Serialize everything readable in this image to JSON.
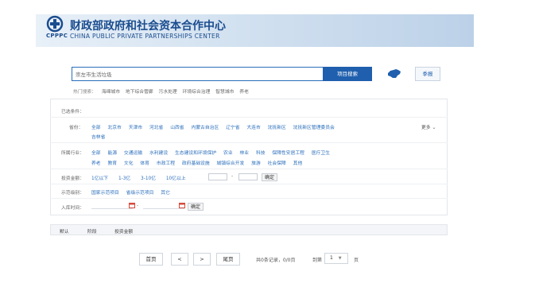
{
  "header": {
    "logo_text": "CPPPC",
    "title_cn": "财政部政府和社会资本合作中心",
    "title_en": "CHINA PUBLIC PRIVATE PARTNERSHIPS CENTER"
  },
  "search": {
    "value": "崇左市生活垃圾",
    "button_label": "项目搜索",
    "quarter_label": "季报"
  },
  "hot": {
    "label": "热门搜索：",
    "items": [
      "海绵城市",
      "地下综合管廊",
      "污水处理",
      "环境综合治理",
      "智慧城市",
      "养老"
    ]
  },
  "filters": {
    "selected_label": "已选条件：",
    "province": {
      "label": "省份：",
      "row1": [
        "全部",
        "北京市",
        "天津市",
        "河北省",
        "山西省",
        "内蒙古自治区",
        "辽宁省",
        "大连市",
        "沈抚新区",
        "沈抚新区管理委员会"
      ],
      "row2": [
        "吉林省"
      ],
      "more": "更多"
    },
    "industry": {
      "label": "所属行业：",
      "row1": [
        "全部",
        "能源",
        "交通运输",
        "水利建设",
        "生态建设和环境保护",
        "农业",
        "林业",
        "科技",
        "保障性安居工程",
        "医疗卫生"
      ],
      "row2": [
        "养老",
        "教育",
        "文化",
        "体育",
        "市政工程",
        "政府基础设施",
        "城镇综合开发",
        "旅游",
        "社会保障",
        "其他"
      ]
    },
    "amount": {
      "label": "投资金额：",
      "options": [
        "1亿以下",
        "1-3亿",
        "3-10亿",
        "10亿以上"
      ],
      "dash": "-",
      "confirm": "确定"
    },
    "demo": {
      "label": "示范级别：",
      "options": [
        "国家示范项目",
        "省级示范项目",
        "其它"
      ]
    },
    "date": {
      "label": "入库时间：",
      "dash": "-",
      "confirm": "确定"
    }
  },
  "tabs": [
    "默认",
    "阶段",
    "投资金额"
  ],
  "pagination": {
    "first": "首页",
    "prev": "<",
    "next": ">",
    "last": "尾页",
    "info": "共0条记录，0/0页",
    "goto": "到第",
    "page_value": "1",
    "unit": "页"
  },
  "colors": {
    "brand": "#1b4d8f",
    "button": "#1f5fae",
    "link": "#2a6ebb"
  }
}
